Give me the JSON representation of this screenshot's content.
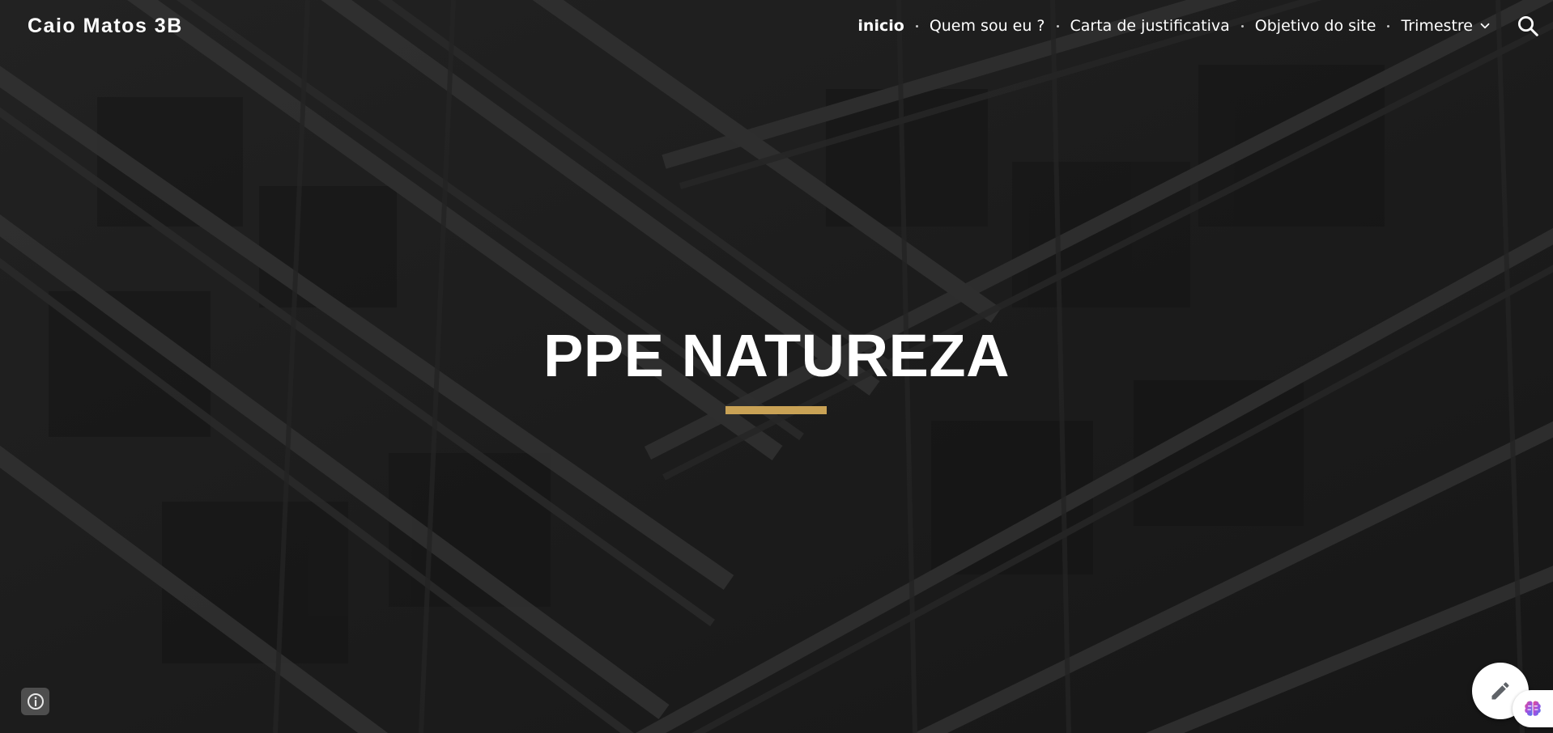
{
  "header": {
    "site_title": "Caio Matos 3B",
    "nav": [
      {
        "label": "inicio",
        "active": true
      },
      {
        "label": "Quem sou eu ?",
        "active": false
      },
      {
        "label": "Carta de justificativa",
        "active": false
      },
      {
        "label": "Objetivo do site",
        "active": false
      },
      {
        "label": "Trimestre",
        "active": false,
        "has_dropdown": true
      }
    ],
    "search_icon": "search-icon",
    "dropdown_icon": "chevron-down-icon"
  },
  "hero": {
    "title": "PPE NATUREZA",
    "accent_color": "#c9a255",
    "background": "dark architectural steel beams photo"
  },
  "floating": {
    "info_icon": "info-icon",
    "edit_icon": "pencil-icon",
    "extension_icon": "brain-icon"
  },
  "colors": {
    "text": "#ffffff",
    "accent": "#c9a255",
    "background": "#1f1f1f"
  }
}
